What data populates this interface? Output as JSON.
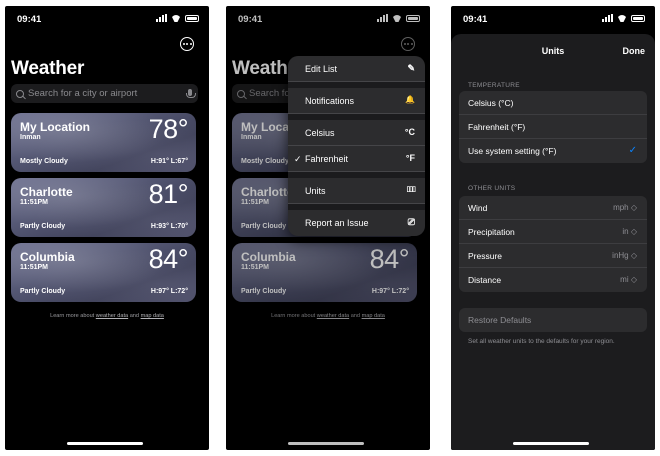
{
  "status_time": "09:41",
  "title": "Weather",
  "search_placeholder": "Search for a city or airport",
  "cards": [
    {
      "city": "My Location",
      "sub": "Inman",
      "temp": "78°",
      "condition": "Mostly Cloudy",
      "hilo": "H:91°  L:67°"
    },
    {
      "city": "Charlotte",
      "sub": "11:51PM",
      "temp": "81°",
      "condition": "Partly Cloudy",
      "hilo": "H:93°  L:70°"
    },
    {
      "city": "Columbia",
      "sub": "11:51PM",
      "temp": "84°",
      "condition": "Partly Cloudy",
      "hilo": "H:97°  L:72°"
    }
  ],
  "footer": {
    "prefix": "Learn more about ",
    "link1": "weather data",
    "and": " and ",
    "link2": "map data"
  },
  "menu": [
    {
      "label": "Edit List",
      "icon": "✎"
    },
    {
      "label": "Notifications",
      "icon": "🔔"
    },
    {
      "label": "Celsius",
      "icon": "°C"
    },
    {
      "label": "Fahrenheit",
      "icon": "°F",
      "checked": "✓"
    },
    {
      "label": "Units",
      "icon": "▯▯▯"
    },
    {
      "label": "Report an Issue",
      "icon": "⎚"
    }
  ],
  "units": {
    "title": "Units",
    "done": "Done",
    "temperature_header": "TEMPERATURE",
    "temperature": [
      "Celsius (°C)",
      "Fahrenheit (°F)",
      "Use system setting (°F)"
    ],
    "checkmark": "✓",
    "other_header": "OTHER UNITS",
    "other": [
      {
        "label": "Wind",
        "value": "mph ◇"
      },
      {
        "label": "Precipitation",
        "value": "in ◇"
      },
      {
        "label": "Pressure",
        "value": "inHg ◇"
      },
      {
        "label": "Distance",
        "value": "mi ◇"
      }
    ],
    "restore": "Restore Defaults",
    "restore_note": "Set all weather units to the defaults for your region."
  }
}
